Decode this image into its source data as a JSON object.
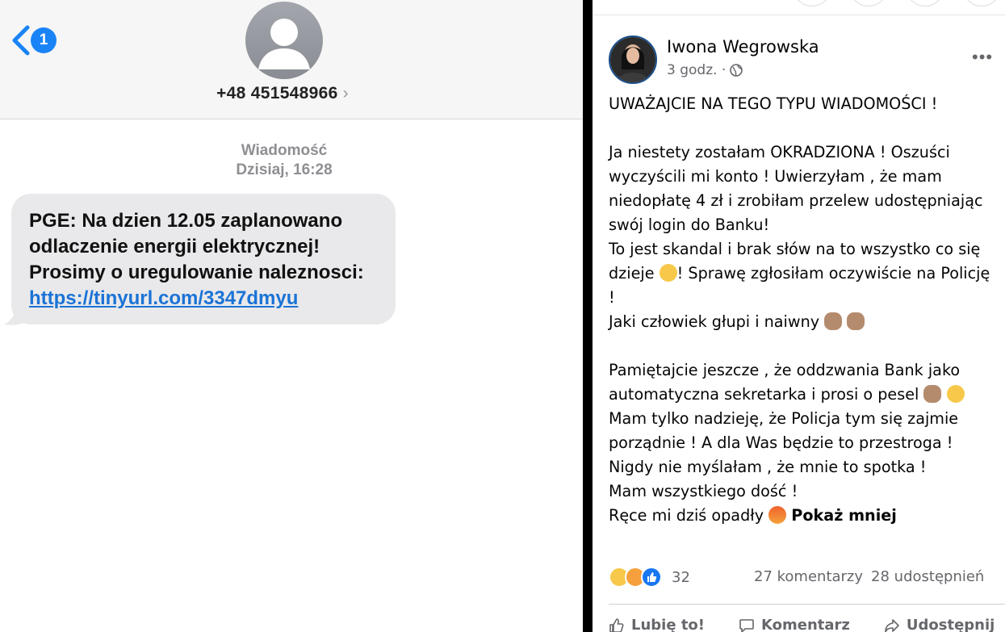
{
  "sms": {
    "unread_count": "1",
    "phone_number": "+48 451548966",
    "number_chevron": "›",
    "label": "Wiadomość",
    "timestamp": "Dzisiaj, 16:28",
    "message_lines": [
      "PGE: Na dzien 12.05 zaplanowano",
      "odlaczenie energii elektrycznej!",
      "Prosimy o uregulowanie naleznosci:"
    ],
    "link": "https://tinyurl.com/3347dmyu",
    "colors": {
      "accent": "#1a84f6",
      "bubble": "#e9e9eb",
      "link": "#1a73d6"
    }
  },
  "post": {
    "author": "Iwona Wegrowska",
    "time": "3 godz. ·",
    "privacy_icon": "globe-icon",
    "more_label": "•••",
    "lines": {
      "l1": "UWAŻAJCIE NA TEGO TYPU WIADOMOŚCI !",
      "l2": "Ja niestety zostałam OKRADZIONA ! Oszuści",
      "l3": "wyczyścili mi konto ! Uwierzyłam , że mam",
      "l4": "niedopłatę 4 zł i zrobiłam przelew udostępniając",
      "l5": "swój login do Banku!",
      "l6": "To jest skandal i brak słów na to wszystko co się",
      "l7a": "dzieje ",
      "l7b": "! Sprawę zgłosiłam oczywiście na Policję",
      "l8": "!",
      "l9": "Jaki człowiek głupi i naiwny ",
      "l10": "Pamiętajcie jeszcze , że oddzwania Bank jako",
      "l11": "automatyczna sekretarka i prosi o pesel ",
      "l12": "Mam tylko nadzieję, że Policja tym się zajmie",
      "l13": "porządnie ! A dla Was będzie to przestroga !",
      "l14": "Nigdy nie myślałam , że mnie to spotka !",
      "l15": "Mam wszystkiego dość !",
      "l16": "Ręce mi dziś opadły "
    },
    "show_less": "Pokaż mniej",
    "reaction_count": "32",
    "comments": "27 komentarzy",
    "shares": "28 udostępnień",
    "actions": {
      "like": "Lubię to!",
      "comment": "Komentarz",
      "share": "Udostępnij"
    },
    "colors": {
      "like_blue": "#1877f2",
      "muted": "#65676b"
    }
  }
}
